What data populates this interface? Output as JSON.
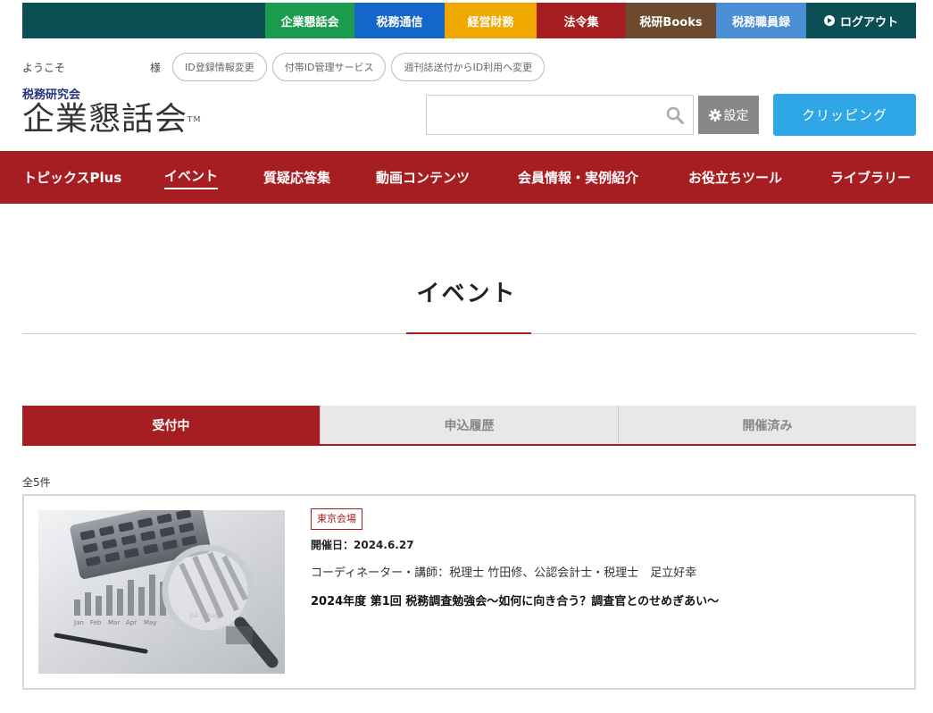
{
  "topbar": {
    "items": [
      {
        "label": "企業懇話会",
        "color": "#1a9b4d"
      },
      {
        "label": "税務通信",
        "color": "#1466c8"
      },
      {
        "label": "経営財務",
        "color": "#f0a800"
      },
      {
        "label": "法令集",
        "color": "#a61e22"
      },
      {
        "label": "税研Books",
        "color": "#6b4a2e"
      },
      {
        "label": "税務職員録",
        "color": "#4a8ed6"
      }
    ],
    "logout": {
      "label": "ログアウト",
      "icon": "play-circle-icon"
    }
  },
  "welcome": {
    "greeting": "ようこそ",
    "suffix": "様",
    "links": [
      "ID登録情報変更",
      "付帯ID管理サービス",
      "週刊誌送付からID利用へ変更"
    ]
  },
  "logo": {
    "small": "税務研究会",
    "big": "企業懇話会",
    "tm": "TM"
  },
  "search": {
    "placeholder": "",
    "icon": "search-icon"
  },
  "settings": {
    "label": "設定",
    "icon": "gear-icon"
  },
  "clipping": {
    "label": "クリッピング"
  },
  "mainnav": {
    "items": [
      "トピックスPlus",
      "イベント",
      "質疑応答集",
      "動画コンテンツ",
      "会員情報・実例紹介",
      "お役立ちツール",
      "ライブラリー"
    ],
    "active": "イベント"
  },
  "page": {
    "title": "イベント"
  },
  "tabs": {
    "items": [
      "受付中",
      "申込履歴",
      "開催済み"
    ],
    "active": "受付中"
  },
  "count": "全5件",
  "events": [
    {
      "venue": "東京会場",
      "date": "開催日：2024.6.27",
      "coordinator": "コーディネーター・講師：税理士 竹田修、公認会計士・税理士　足立好幸",
      "title": "2024年度 第1回 税務調査勉強会～如何に向き合う？調査官とのせめぎあい～",
      "image": "calculator-and-magnifying-glass-photo"
    }
  ],
  "colors": {
    "brand_red": "#a61e22",
    "topbar_bg": "#0b4f55",
    "clip_blue": "#2fa7e6"
  }
}
